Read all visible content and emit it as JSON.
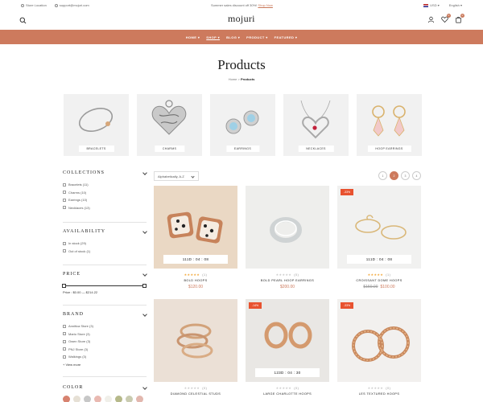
{
  "topbar": {
    "store_location": "Store Location",
    "email": "support@mojuri.com",
    "promo_text": "Summer sales discount off 30%!",
    "promo_link": "Shop Now",
    "currency": "USD",
    "language": "English"
  },
  "header": {
    "logo": "mojuri",
    "wishlist_count": "0",
    "cart_count": "0"
  },
  "nav": {
    "items": [
      "HOME",
      "SHOP",
      "BLOG",
      "PRODUCT",
      "FEATURED"
    ],
    "active": "SHOP"
  },
  "page": {
    "title": "Products",
    "breadcrumb_home": "Home",
    "breadcrumb_current": "Products"
  },
  "categories": [
    {
      "label": "BRACELETS",
      "icon": "bracelet-icon"
    },
    {
      "label": "CHARMS",
      "icon": "charm-icon"
    },
    {
      "label": "EARRINGS",
      "icon": "earrings-icon"
    },
    {
      "label": "NECKLACES",
      "icon": "necklace-icon"
    },
    {
      "label": "HOOP EARRINGS",
      "icon": "hoop-earrings-icon"
    }
  ],
  "sidebar": {
    "collections": {
      "title": "COLLECTIONS",
      "options": [
        "Bracelets (11)",
        "Charms (10)",
        "Earrings (10)",
        "Necklaces (13)"
      ]
    },
    "availability": {
      "title": "AVAILABILITY",
      "options": [
        "In stock (29)",
        "Out of stock (1)"
      ]
    },
    "price": {
      "title": "PRICE",
      "range_text": "Price : $0.00 — $214.22",
      "min": 0,
      "max": 214.22
    },
    "brand": {
      "title": "BRAND",
      "options": [
        "Annitica Store (3)",
        "Mario Store (3)",
        "Owen Store (3)",
        "PNJ Store (3)",
        "Walkings (3)"
      ],
      "view_more": "+ View more"
    },
    "color": {
      "title": "COLOR",
      "swatches": [
        "#d7826f",
        "#e6e0d5",
        "#c7c7c7",
        "#e9b9b1",
        "#f0efe9",
        "#b6b98a",
        "#c9cbb0",
        "#e2b7ae"
      ]
    }
  },
  "toolbar": {
    "sort_label": "Alphabetically, A-Z",
    "views": [
      "1",
      "2",
      "3",
      "4"
    ],
    "active_view": "2"
  },
  "products": [
    {
      "name": "BOLD HOOPS",
      "price": "$120.00",
      "old_price": "",
      "discount": "",
      "timer": "111D : 04 : 08",
      "rating": 5,
      "reviews": "(1)"
    },
    {
      "name": "BOLD PEARL HOOP EARRINGS",
      "price": "$200.00",
      "old_price": "",
      "discount": "",
      "timer": "",
      "rating": 0,
      "reviews": "(0)"
    },
    {
      "name": "CROISSANT DOME HOOPS",
      "price": "$100.00",
      "old_price": "$150.00",
      "discount": "-33%",
      "timer": "111D : 04 : 08",
      "rating": 5,
      "reviews": "(1)"
    },
    {
      "name": "DIAMOND CELESTIAL STUDS",
      "price": "",
      "old_price": "",
      "discount": "",
      "timer": "",
      "rating": 0,
      "reviews": "(0)"
    },
    {
      "name": "LARGE CHARLOTTE HOOPS",
      "price": "",
      "old_price": "",
      "discount": "-14%",
      "timer": "123D : 04 : 30",
      "rating": 0,
      "reviews": "(0)"
    },
    {
      "name": "LES TEXTURED HOOPS",
      "price": "",
      "old_price": "",
      "discount": "-33%",
      "timer": "",
      "rating": 0,
      "reviews": "(0)"
    }
  ]
}
